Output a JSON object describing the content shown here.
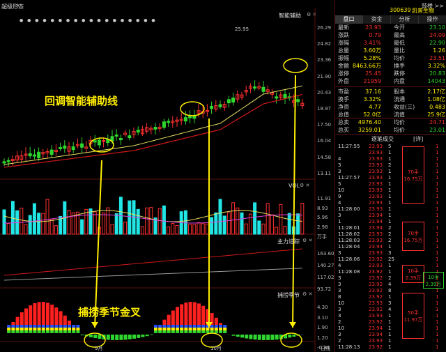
{
  "top_label": "超级形态",
  "charts": {
    "main": {
      "indicator": "智能辅助",
      "y_ticks": [
        "26.29",
        "24.82",
        "23.36",
        "21.90",
        "20.43",
        "18.97",
        "17.50",
        "16.04",
        "14.58",
        "13.11"
      ],
      "peak": "25.95",
      "dots": "● ● ● ● ● ● ● ● ● ● ● ● ● ● ● ● ● ●"
    },
    "vol": {
      "indicator": "VOL",
      "y_ticks": [
        "11.91",
        "8.93",
        "5.96",
        "2.98",
        "万手"
      ]
    },
    "flow": {
      "indicator": "主力追踪",
      "y_ticks": [
        "163.60",
        "140.27",
        "117.02",
        "93.72"
      ]
    },
    "capture": {
      "indicator": "捕捞季节",
      "y_ticks": [
        "4.30",
        "3.10",
        "1.90",
        "1.20",
        "-0.35"
      ]
    },
    "x_ticks": [
      "9月",
      "10月"
    ],
    "right_col_label": "日线"
  },
  "annotations": {
    "assist_line": "回调智能辅助线",
    "golden_cross": "捕捞季节金叉"
  },
  "panel": {
    "top_btn": "鼓楼 >>",
    "code": "300639",
    "name": "凯普生物",
    "tabs": [
      "盘口",
      "资金",
      "分析",
      "操作"
    ],
    "quotes": [
      [
        "最新",
        "23.93",
        "今开",
        "23.10"
      ],
      [
        "涨跌",
        "0.79",
        "最高",
        "24.09"
      ],
      [
        "涨幅",
        "3.41%",
        "最低",
        "22.90"
      ],
      [
        "总量",
        "3.60万",
        "量比",
        "1.26"
      ],
      [
        "振幅",
        "5.28%",
        "均价",
        "23.51"
      ],
      [
        "金额",
        "8463.66万",
        "换手",
        "3.32%"
      ],
      [
        "涨停",
        "25.45",
        "跌停",
        "20.83"
      ],
      [
        "外盘",
        "21959",
        "内盘",
        "14043"
      ]
    ],
    "fund": [
      [
        "市盈",
        "37.16",
        "股本",
        "2.17亿"
      ],
      [
        "换手",
        "3.32%",
        "流通",
        "1.08亿"
      ],
      [
        "净资",
        "4.77",
        "收益(三)",
        "0.483"
      ],
      [
        "总值",
        "52.0亿",
        "流值",
        "25.9亿"
      ]
    ],
    "sell_buy": [
      [
        "总卖",
        "4976.40",
        "均价",
        "24.71"
      ],
      [
        "总买",
        "3259.01",
        "均价",
        "23.01"
      ]
    ],
    "ticks_title": "逐笔成交",
    "ticks_btn": "[详]",
    "ticks": [
      [
        "11:27:55",
        "23.93",
        "5",
        "1"
      ],
      [
        "",
        "23.93",
        "1",
        "1"
      ],
      [
        "4",
        "23.93",
        "1",
        "1"
      ],
      [
        "3",
        "23.93",
        "2",
        "1"
      ],
      [
        "3",
        "23.93",
        "1",
        "1"
      ],
      [
        "11:27:57",
        "23.93",
        "1",
        "1"
      ],
      [
        "5",
        "23.93",
        "1",
        "1"
      ],
      [
        "10",
        "23.93",
        "1",
        "1"
      ],
      [
        "9",
        "23.93",
        "1",
        "1"
      ],
      [
        "4",
        "23.93",
        "1",
        "1"
      ],
      [
        "11:28:00",
        "23.93",
        "1",
        "1"
      ],
      [
        "3",
        "23.94",
        "1",
        "1"
      ],
      [
        "1",
        "23.94",
        "1",
        "1"
      ],
      [
        "11:28:01",
        "23.94",
        "2",
        "1"
      ],
      [
        "11:28:02",
        "23.93",
        "2",
        "1"
      ],
      [
        "11:28:03",
        "23.93",
        "2",
        "1"
      ],
      [
        "11:28:04",
        "23.94",
        "1",
        "1"
      ],
      [
        "3",
        "23.93",
        "3",
        "1"
      ],
      [
        "11:28:06",
        "23.92",
        "25",
        "1"
      ],
      [
        "4",
        "23.93",
        "1",
        "1"
      ],
      [
        "11:28:08",
        "23.92",
        "1",
        "1"
      ],
      [
        "3",
        "23.92",
        "2",
        "1"
      ],
      [
        "3",
        "23.92",
        "4",
        "1"
      ],
      [
        "3",
        "23.92",
        "8",
        "1"
      ],
      [
        "8",
        "23.92",
        "1",
        "1"
      ],
      [
        "10",
        "23.93",
        "3",
        "1"
      ],
      [
        "3",
        "23.92",
        "4",
        "1"
      ],
      [
        "3",
        "23.93",
        "1",
        "1"
      ],
      [
        "2",
        "23.92",
        "1",
        "1"
      ],
      [
        "10",
        "23.94",
        "1",
        "1"
      ],
      [
        "3",
        "23.94",
        "1",
        "1"
      ],
      [
        "2",
        "23.93",
        "1",
        "1"
      ],
      [
        "11:28:13",
        "23.92",
        "1",
        "1"
      ]
    ],
    "block_labels": [
      [
        "70手",
        "16.75万"
      ],
      [
        "70手",
        "16.75万"
      ],
      [
        "10手",
        "2.39万"
      ],
      [
        "10手",
        "2.39万"
      ],
      [
        "50手",
        "11.97万"
      ]
    ]
  },
  "colors": {
    "up": "#ff3030",
    "down": "#2fd62f",
    "accent": "#ffee00",
    "cyan": "#22e6e6"
  }
}
